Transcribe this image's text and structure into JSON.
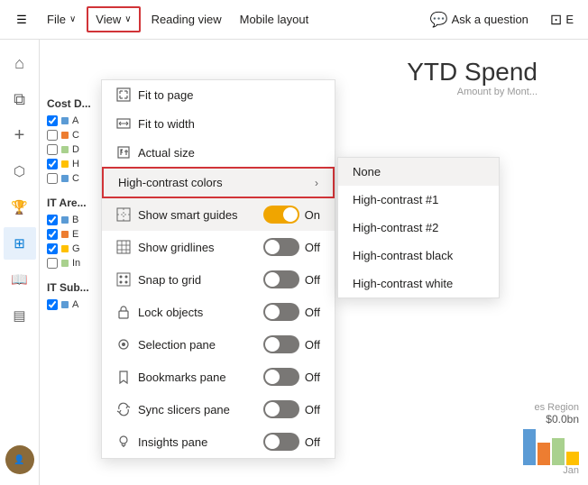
{
  "toolbar": {
    "hamburger_icon": "☰",
    "file_label": "File",
    "view_label": "View",
    "reading_view_label": "Reading view",
    "mobile_layout_label": "Mobile layout",
    "ask_question_label": "Ask a question",
    "edit_label": "E",
    "chevron": "∨"
  },
  "sidebar": {
    "icons": [
      {
        "name": "home",
        "glyph": "⌂",
        "active": false
      },
      {
        "name": "layers",
        "glyph": "⧉",
        "active": false
      },
      {
        "name": "plus",
        "glyph": "+",
        "active": false
      },
      {
        "name": "database",
        "glyph": "⬡",
        "active": false
      },
      {
        "name": "trophy",
        "glyph": "🏆",
        "active": false
      },
      {
        "name": "grid",
        "glyph": "⊞",
        "active": true
      },
      {
        "name": "book",
        "glyph": "📖",
        "active": false
      },
      {
        "name": "chart",
        "glyph": "▤",
        "active": false
      }
    ],
    "avatar_initials": ""
  },
  "report": {
    "title": "YTD Spend",
    "subtitle": "Amount by Mont...",
    "left_panel": {
      "header1": "Cost D...",
      "items1": [
        {
          "label": "A",
          "color": "#5b9bd5"
        },
        {
          "label": "C",
          "color": "#ed7d31"
        },
        {
          "label": "D",
          "color": "#a9d18e"
        },
        {
          "label": "H",
          "color": "#ffc000"
        },
        {
          "label": "C",
          "color": "#5b9bd5"
        }
      ],
      "header2": "IT Are...",
      "items2": [
        {
          "label": "B",
          "color": "#5b9bd5"
        },
        {
          "label": "E",
          "color": "#ed7d31"
        },
        {
          "label": "G",
          "color": "#ffc000"
        },
        {
          "label": "In",
          "color": "#a9d18e"
        }
      ],
      "header3": "IT Sub...",
      "items3": [
        {
          "label": "A",
          "color": "#5b9bd5"
        }
      ]
    },
    "chart_value": "$0.0bn",
    "chart_label": "Jan",
    "region_label": "es Region"
  },
  "view_menu": {
    "items": [
      {
        "label": "Fit to page",
        "icon": "fit-page",
        "icon_glyph": "⊡",
        "has_toggle": false,
        "has_submenu": false
      },
      {
        "label": "Fit to width",
        "icon": "fit-width",
        "icon_glyph": "⊞",
        "has_toggle": false,
        "has_submenu": false
      },
      {
        "label": "Actual size",
        "icon": "actual-size",
        "icon_glyph": "⊡",
        "has_toggle": false,
        "has_submenu": false
      },
      {
        "label": "High-contrast colors",
        "icon": "contrast",
        "icon_glyph": "",
        "has_toggle": false,
        "has_submenu": true,
        "highlighted": true
      },
      {
        "label": "Show smart guides",
        "icon": "smart-guides",
        "icon_glyph": "⊞",
        "has_toggle": true,
        "toggle_on": true,
        "toggle_text": "On",
        "has_submenu": false,
        "smart_guides": true
      },
      {
        "label": "Show gridlines",
        "icon": "gridlines",
        "icon_glyph": "⊞",
        "has_toggle": true,
        "toggle_on": false,
        "toggle_text": "Off",
        "has_submenu": false
      },
      {
        "label": "Snap to grid",
        "icon": "snap-grid",
        "icon_glyph": "⊞",
        "has_toggle": true,
        "toggle_on": false,
        "toggle_text": "Off",
        "has_submenu": false
      },
      {
        "label": "Lock objects",
        "icon": "lock",
        "icon_glyph": "🔒",
        "has_toggle": true,
        "toggle_on": false,
        "toggle_text": "Off",
        "has_submenu": false
      },
      {
        "label": "Selection pane",
        "icon": "selection",
        "icon_glyph": "◉",
        "has_toggle": true,
        "toggle_on": false,
        "toggle_text": "Off",
        "has_submenu": false
      },
      {
        "label": "Bookmarks pane",
        "icon": "bookmarks",
        "icon_glyph": "🔖",
        "has_toggle": true,
        "toggle_on": false,
        "toggle_text": "Off",
        "has_submenu": false
      },
      {
        "label": "Sync slicers pane",
        "icon": "sync-slicers",
        "icon_glyph": "↻",
        "has_toggle": true,
        "toggle_on": false,
        "toggle_text": "Off",
        "has_submenu": false
      },
      {
        "label": "Insights pane",
        "icon": "insights",
        "icon_glyph": "💡",
        "has_toggle": true,
        "toggle_on": false,
        "toggle_text": "Off",
        "has_submenu": false
      }
    ]
  },
  "high_contrast_submenu": {
    "items": [
      {
        "label": "None",
        "selected": true
      },
      {
        "label": "High-contrast #1",
        "selected": false
      },
      {
        "label": "High-contrast #2",
        "selected": false
      },
      {
        "label": "High-contrast black",
        "selected": false
      },
      {
        "label": "High-contrast white",
        "selected": false
      }
    ]
  },
  "colors": {
    "active_border": "#d13438",
    "toggle_on": "#f0a500",
    "toggle_off": "#797775",
    "accent": "#0078d4"
  }
}
